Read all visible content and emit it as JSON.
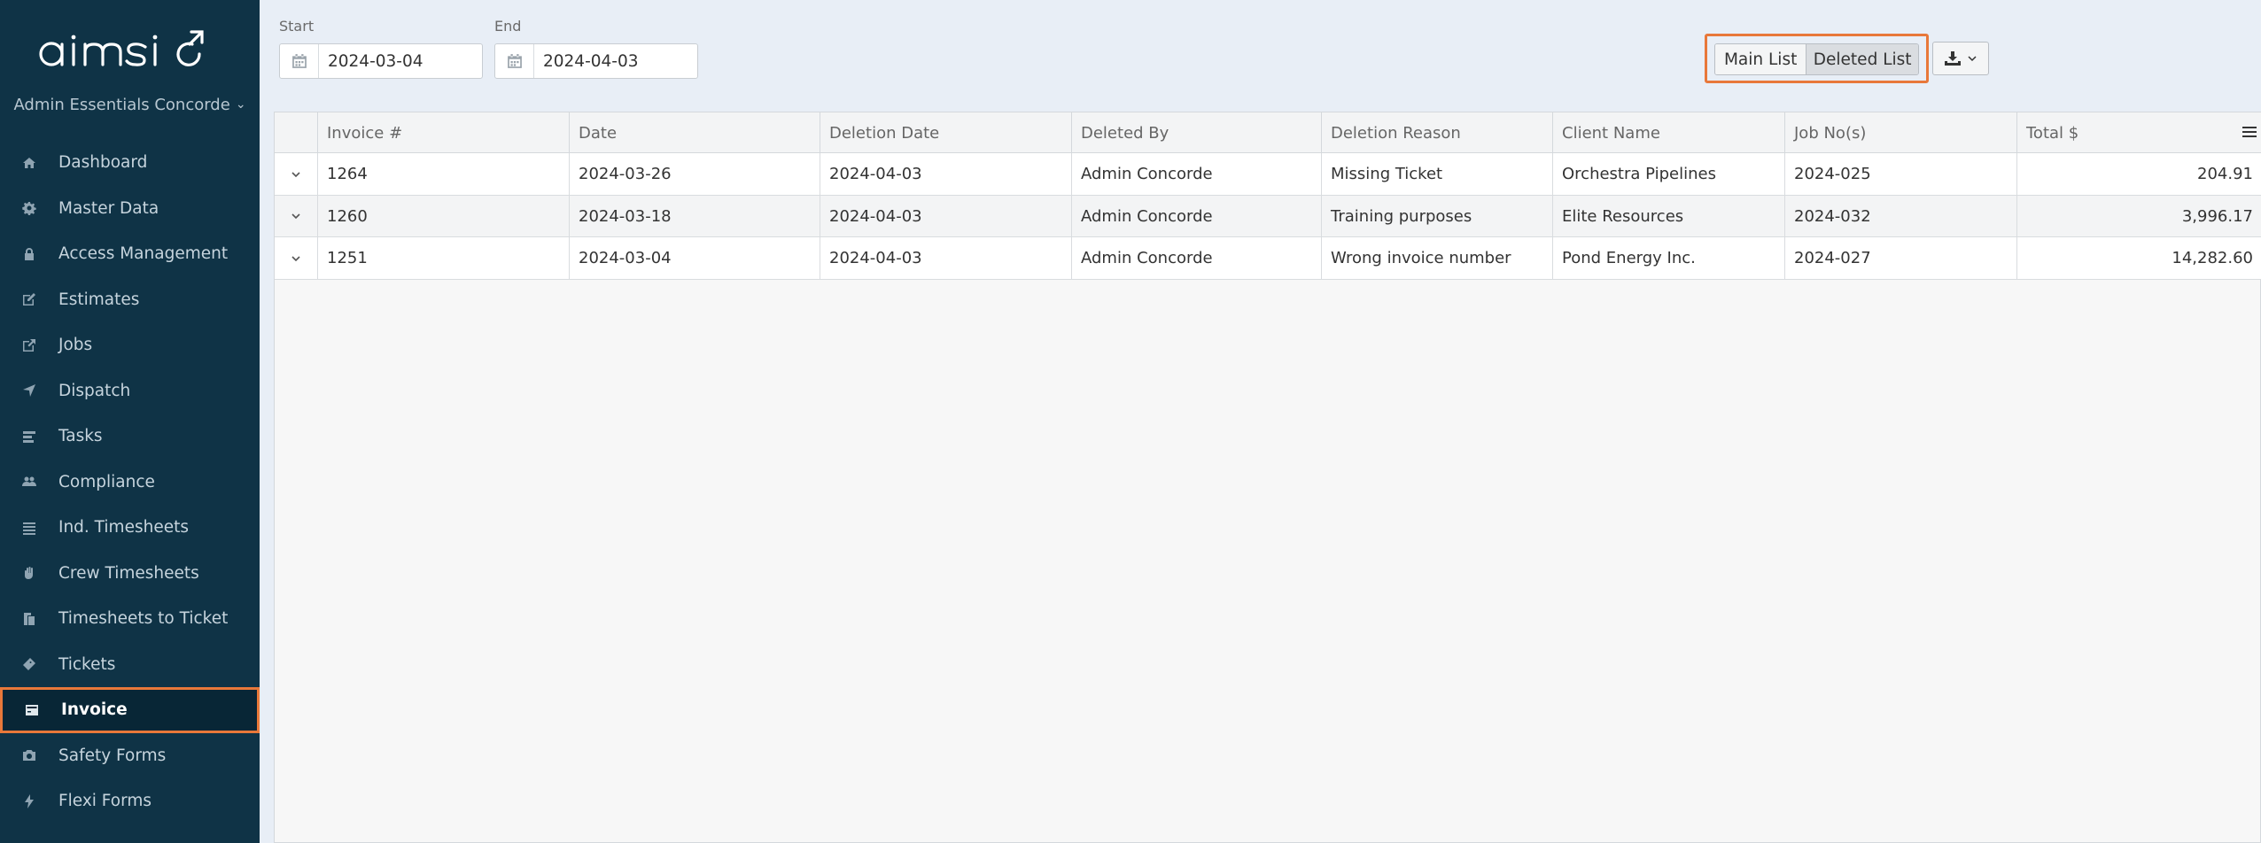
{
  "sidebar": {
    "company": "Admin Essentials Concorde",
    "items": [
      {
        "label": "Dashboard",
        "icon": "dashboard-icon"
      },
      {
        "label": "Master Data",
        "icon": "gear-icon"
      },
      {
        "label": "Access Management",
        "icon": "lock-icon"
      },
      {
        "label": "Estimates",
        "icon": "edit-icon"
      },
      {
        "label": "Jobs",
        "icon": "external-link-icon"
      },
      {
        "label": "Dispatch",
        "icon": "location-arrow-icon"
      },
      {
        "label": "Tasks",
        "icon": "tasks-icon"
      },
      {
        "label": "Compliance",
        "icon": "users-icon"
      },
      {
        "label": "Ind. Timesheets",
        "icon": "list-icon"
      },
      {
        "label": "Crew Timesheets",
        "icon": "hand-icon"
      },
      {
        "label": "Timesheets to Ticket",
        "icon": "copy-icon"
      },
      {
        "label": "Tickets",
        "icon": "ticket-icon"
      },
      {
        "label": "Invoice",
        "icon": "invoice-icon",
        "active": true
      },
      {
        "label": "Safety Forms",
        "icon": "camera-icon"
      },
      {
        "label": "Flexi Forms",
        "icon": "bolt-icon"
      }
    ]
  },
  "filters": {
    "start_label": "Start",
    "start_value": "2024-03-04",
    "end_label": "End",
    "end_value": "2024-04-03"
  },
  "toolbar": {
    "main_list": "Main List",
    "deleted_list": "Deleted List"
  },
  "table": {
    "columns": [
      "Invoice #",
      "Date",
      "Deletion Date",
      "Deleted By",
      "Deletion Reason",
      "Client Name",
      "Job No(s)",
      "Total $"
    ],
    "rows": [
      [
        "1264",
        "2024-03-26",
        "2024-04-03",
        "Admin Concorde",
        "Missing Ticket",
        "Orchestra Pipelines",
        "2024-025",
        "204.91"
      ],
      [
        "1260",
        "2024-03-18",
        "2024-04-03",
        "Admin Concorde",
        "Training purposes",
        "Elite Resources",
        "2024-032",
        "3,996.17"
      ],
      [
        "1251",
        "2024-03-04",
        "2024-04-03",
        "Admin Concorde",
        "Wrong invoice number",
        "Pond Energy Inc.",
        "2024-027",
        "14,282.60"
      ]
    ]
  },
  "colors": {
    "sidebar_bg": "#0f3346",
    "highlight": "#e8783a"
  }
}
